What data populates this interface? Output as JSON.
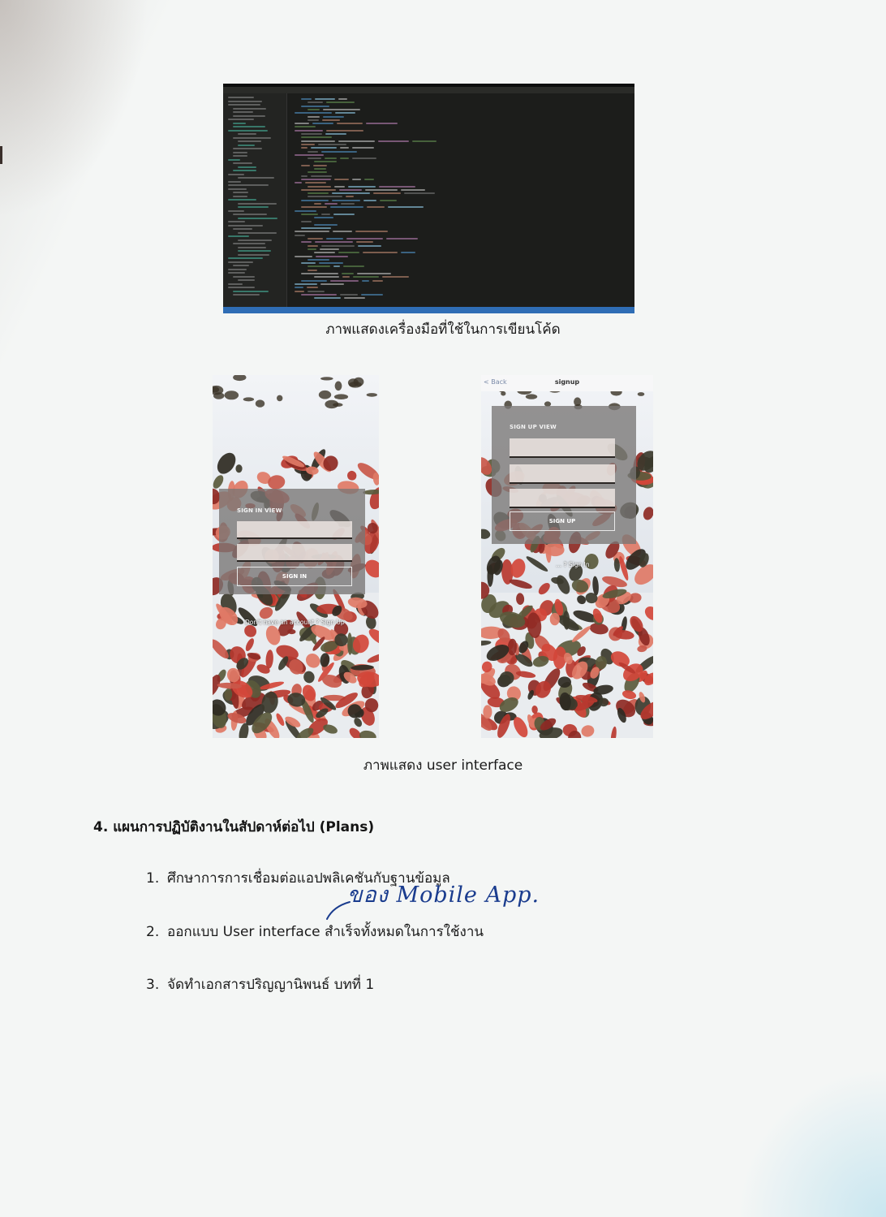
{
  "figure_code": {
    "caption": "ภาพแสดงเครื่องมือที่ใช้ในการเขียนโค้ด"
  },
  "figure_ui": {
    "caption": "ภาพแสดง  user interface",
    "signin_screen": {
      "form_title": "SIGN IN VIEW",
      "button": "SIGN IN",
      "switch_link": "Don't have an account ? Sign Up"
    },
    "signup_screen": {
      "nav_back": "< Back",
      "nav_title": "signup",
      "form_title": "SIGN UP VIEW",
      "button": "SIGN UP",
      "switch_link": "... ? Sign In"
    }
  },
  "plans": {
    "heading": "4. แผนการปฏิบัติงานในสัปดาห์ต่อไป (Plans)",
    "items": [
      {
        "number": "1.",
        "text": "ศึกษาการการเชื่อมต่อแอปพลิเคชันกับฐานข้อมูล"
      },
      {
        "number": "2.",
        "text": "ออกแบบ User interface สำเร็จทั้งหมดในการใช้งาน"
      },
      {
        "number": "3.",
        "text": "จัดทำเอกสารปริญญานิพนธ์  บทที่  1"
      }
    ],
    "handwritten_note": "ของ Mobile App."
  },
  "colors": {
    "ink": "#1b1b1b",
    "handwriting": "#1a3c8e",
    "editor_bg": "#1c1d1b",
    "statusbar": "#2f6db5"
  }
}
